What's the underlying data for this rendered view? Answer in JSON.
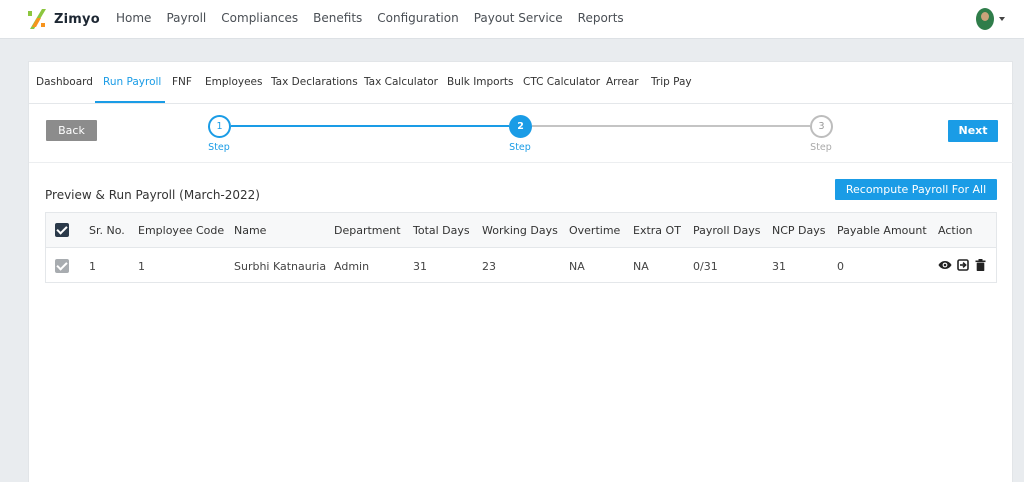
{
  "brand": {
    "name": "Zimyo",
    "colors": {
      "primary": "#1a9ce6",
      "logo_green": "#8cc63f",
      "logo_orange": "#f7941d"
    }
  },
  "top_nav": [
    "Home",
    "Payroll",
    "Compliances",
    "Benefits",
    "Configuration",
    "Payout Service",
    "Reports"
  ],
  "user_menu": {
    "avatar_icon": "user-avatar",
    "caret_icon": "caret-down-icon"
  },
  "tabs": [
    {
      "label": "Dashboard",
      "active": false
    },
    {
      "label": "Run Payroll",
      "active": true
    },
    {
      "label": "FNF",
      "active": false
    },
    {
      "label": "Employees",
      "active": false
    },
    {
      "label": "Tax Declarations",
      "active": false
    },
    {
      "label": "Tax Calculator",
      "active": false
    },
    {
      "label": "Bulk Imports",
      "active": false
    },
    {
      "label": "CTC Calculator",
      "active": false
    },
    {
      "label": "Arrear",
      "active": false
    },
    {
      "label": "Trip Pay",
      "active": false
    }
  ],
  "wizard": {
    "back_label": "Back",
    "next_label": "Next",
    "steps": [
      {
        "number": "1",
        "label": "Step",
        "state": "done"
      },
      {
        "number": "2",
        "label": "Step",
        "state": "current"
      },
      {
        "number": "3",
        "label": "Step",
        "state": "pending"
      }
    ]
  },
  "section": {
    "title": "Preview & Run Payroll (March-2022)",
    "recompute_label": "Recompute Payroll For All"
  },
  "table": {
    "select_all_checked": true,
    "columns": [
      "Sr. No.",
      "Employee Code",
      "Name",
      "Department",
      "Total Days",
      "Working Days",
      "Overtime",
      "Extra OT",
      "Payroll Days",
      "NCP Days",
      "Payable Amount",
      "Action"
    ],
    "rows": [
      {
        "checked": true,
        "cells": [
          "1",
          "1",
          "Surbhi Katnauria",
          "Admin",
          "31",
          "23",
          "NA",
          "NA",
          "0/31",
          "31",
          "0"
        ],
        "actions": [
          "eye-icon",
          "sign-in-icon",
          "trash-icon"
        ]
      }
    ]
  }
}
